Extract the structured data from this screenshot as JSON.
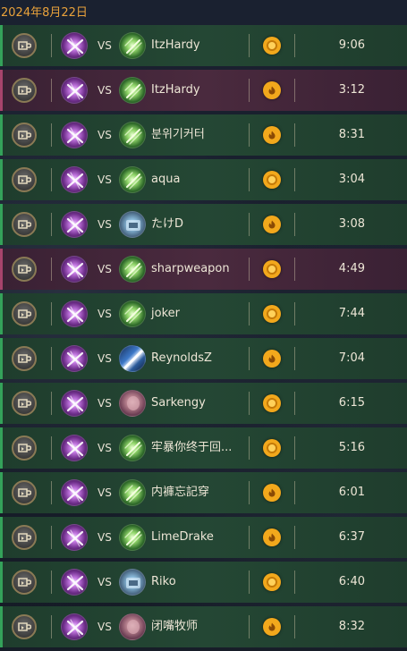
{
  "header": {
    "date": "2024年8月22日"
  },
  "labels": {
    "vs": "VS"
  },
  "matches": [
    {
      "result": "win",
      "opponent": "ItzHardy",
      "opponent_avatar": "green",
      "result_icon": "coin-icon",
      "duration": "9:06"
    },
    {
      "result": "loss",
      "opponent": "ItzHardy",
      "opponent_avatar": "green",
      "result_icon": "flame-icon",
      "duration": "3:12"
    },
    {
      "result": "win",
      "opponent": "분위기커터",
      "opponent_avatar": "green",
      "result_icon": "flame-icon",
      "duration": "8:31"
    },
    {
      "result": "win",
      "opponent": "aqua",
      "opponent_avatar": "green",
      "result_icon": "coin-icon",
      "duration": "3:04"
    },
    {
      "result": "win",
      "opponent": "たけD",
      "opponent_avatar": "mech",
      "result_icon": "flame-icon",
      "duration": "3:08"
    },
    {
      "result": "loss",
      "opponent": "sharpweapon",
      "opponent_avatar": "green",
      "result_icon": "coin-icon",
      "duration": "4:49"
    },
    {
      "result": "win",
      "opponent": "joker",
      "opponent_avatar": "green",
      "result_icon": "coin-icon",
      "duration": "7:44"
    },
    {
      "result": "win",
      "opponent": "ReynoldsZ",
      "opponent_avatar": "blue",
      "result_icon": "flame-icon",
      "duration": "7:04"
    },
    {
      "result": "win",
      "opponent": "Sarkengy",
      "opponent_avatar": "pink",
      "result_icon": "coin-icon",
      "duration": "6:15"
    },
    {
      "result": "win",
      "opponent": "牢暴你终于回...",
      "opponent_avatar": "green",
      "result_icon": "coin-icon",
      "duration": "5:16"
    },
    {
      "result": "win",
      "opponent": "内褲忘記穿",
      "opponent_avatar": "green",
      "result_icon": "flame-icon",
      "duration": "6:01"
    },
    {
      "result": "win",
      "opponent": "LimeDrake",
      "opponent_avatar": "green",
      "result_icon": "flame-icon",
      "duration": "6:37"
    },
    {
      "result": "win",
      "opponent": "Riko",
      "opponent_avatar": "mech",
      "result_icon": "coin-icon",
      "duration": "6:40"
    },
    {
      "result": "win",
      "opponent": "闭嘴牧师",
      "opponent_avatar": "pink",
      "result_icon": "flame-icon",
      "duration": "8:32"
    }
  ],
  "colors": {
    "accent": "#e9a23b",
    "win_row": "#244734",
    "loss_row": "#4a2a3e",
    "result_icon": "#f2a81c"
  }
}
